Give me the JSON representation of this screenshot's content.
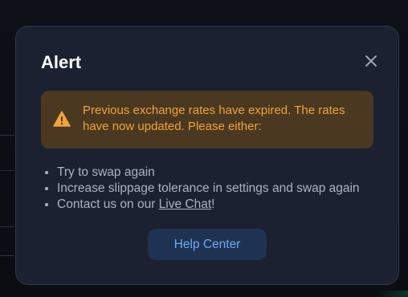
{
  "modal": {
    "title": "Alert",
    "close_icon": "close-icon",
    "alert": {
      "icon": "warning-icon",
      "message": "Previous exchange rates have expired. The rates have now updated. Please either:",
      "color": "#f2a33a",
      "background": "#4a3820"
    },
    "options": [
      {
        "text": "Try to swap again"
      },
      {
        "text": "Increase slippage tolerance in settings and swap again"
      },
      {
        "prefix": "Contact us on our ",
        "link": "Live Chat",
        "suffix": "!"
      }
    ],
    "help_button_label": "Help Center",
    "accent_color": "#6ea8f5",
    "background_color": "#1b2130"
  }
}
